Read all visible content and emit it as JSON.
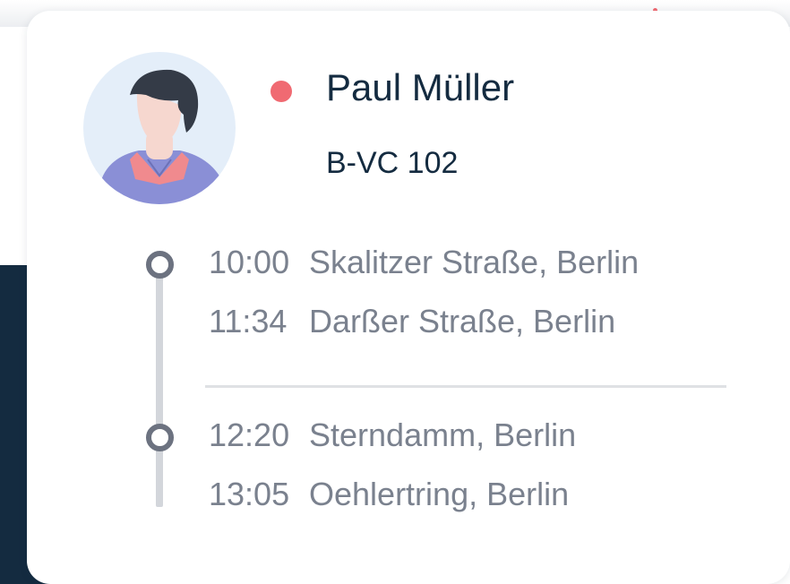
{
  "driver": {
    "name": "Paul Müller",
    "plate": "B-VC 102",
    "status_color": "#f06a72",
    "avatar_icon": "person-avatar-icon"
  },
  "stops": [
    {
      "time": "10:00",
      "address": "Skalitzer Straße, Berlin"
    },
    {
      "time": "11:34",
      "address": "Darßer Straße, Berlin"
    },
    {
      "time": "12:20",
      "address": "Sterndamm, Berlin"
    },
    {
      "time": "13:05",
      "address": "Oehlertring, Berlin"
    }
  ],
  "colors": {
    "navy": "#142b40",
    "muted_text": "#7a818e",
    "timeline": "#d3d6db"
  }
}
